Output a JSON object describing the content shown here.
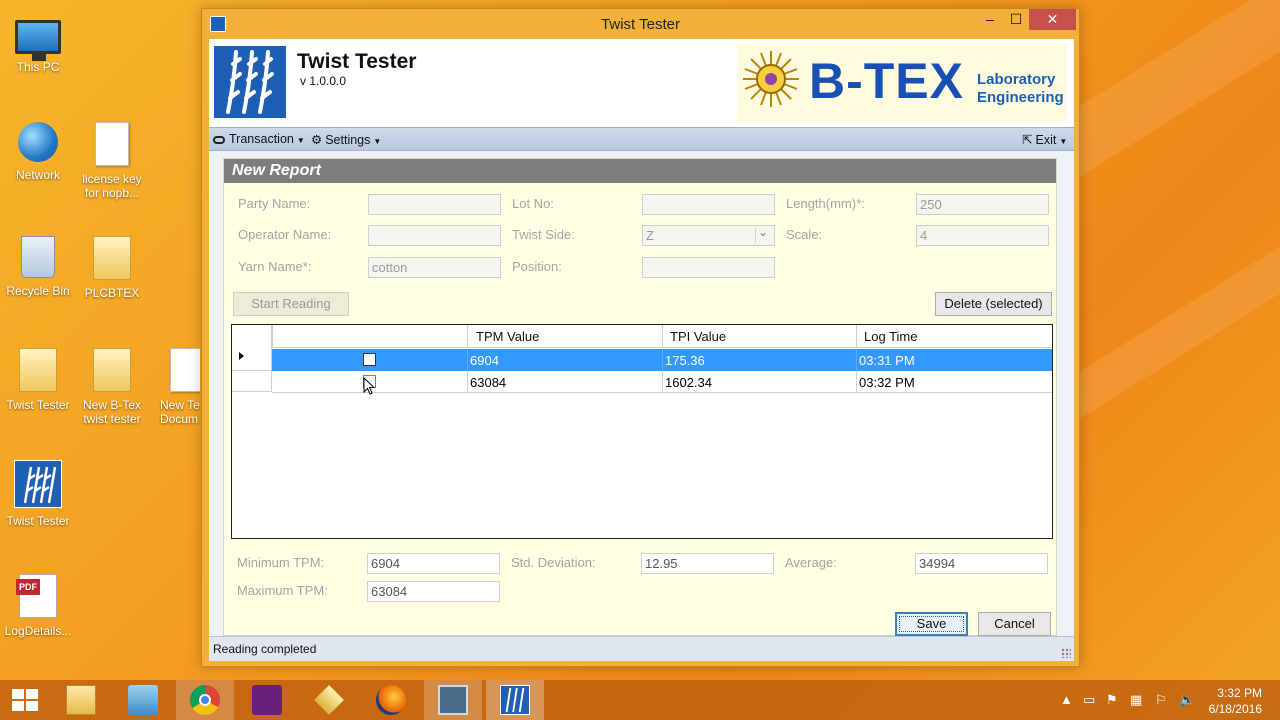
{
  "desktop": {
    "icons": [
      {
        "label": "This PC"
      },
      {
        "label": "Network"
      },
      {
        "label": "license key for nopb..."
      },
      {
        "label": "Recycle Bin"
      },
      {
        "label": "PLCBTEX"
      },
      {
        "label": "Twist Tester"
      },
      {
        "label": "New B-Tex twist tester"
      },
      {
        "label": "New Te Docum"
      },
      {
        "label": "Twist Tester"
      },
      {
        "label": "LogDetails..."
      }
    ],
    "pdf_tag": "PDF"
  },
  "window": {
    "title": "Twist Tester",
    "controls": {
      "minimize": "–",
      "maximize": "☐",
      "close": "✕"
    }
  },
  "header": {
    "app_name": "Twist Tester",
    "version": "v 1.0.0.0",
    "brand_name": "B-TEX",
    "brand_line1": "Laboratory",
    "brand_line2": "Engineering"
  },
  "menu": {
    "transaction": "Transaction",
    "settings": "Settings",
    "exit": "Exit"
  },
  "report": {
    "heading": "New Report",
    "fields": {
      "party_name": {
        "label": "Party Name:",
        "value": ""
      },
      "lot_no": {
        "label": "Lot No:",
        "value": ""
      },
      "length": {
        "label": "Length(mm)*:",
        "value": "250"
      },
      "operator_name": {
        "label": "Operator Name:",
        "value": ""
      },
      "twist_side": {
        "label": "Twist Side:",
        "value": "Z"
      },
      "scale": {
        "label": "Scale:",
        "value": "4"
      },
      "yarn_name": {
        "label": "Yarn Name*:",
        "value": "cotton"
      },
      "position": {
        "label": "Position:",
        "value": ""
      }
    },
    "start_reading": "Start Reading",
    "delete_selected": "Delete (selected)",
    "grid": {
      "columns": [
        "TPM Value",
        "TPI Value",
        "Log Time"
      ],
      "rows": [
        {
          "tpm": "6904",
          "tpi": "175.36",
          "time": "03:31  PM",
          "selected": true
        },
        {
          "tpm": "63084",
          "tpi": "1602.34",
          "time": "03:32  PM",
          "selected": false
        }
      ]
    },
    "stats": {
      "min_tpm": {
        "label": "Minimum TPM:",
        "value": "6904"
      },
      "std_dev": {
        "label": "Std. Deviation:",
        "value": "12.95"
      },
      "average": {
        "label": "Average:",
        "value": "34994"
      },
      "max_tpm": {
        "label": "Maximum TPM:",
        "value": "63084"
      }
    },
    "save": "Save",
    "cancel": "Cancel"
  },
  "status": {
    "text": "Reading completed"
  },
  "taskbar": {
    "time": "3:32 PM",
    "date": "6/18/2016",
    "tray_caret": "▲"
  },
  "colors": {
    "accent_selection": "#3399ff",
    "brand_blue": "#1a4fb5",
    "panel_bg": "#ffffe4",
    "desktop_orange": "#f39a1e"
  }
}
